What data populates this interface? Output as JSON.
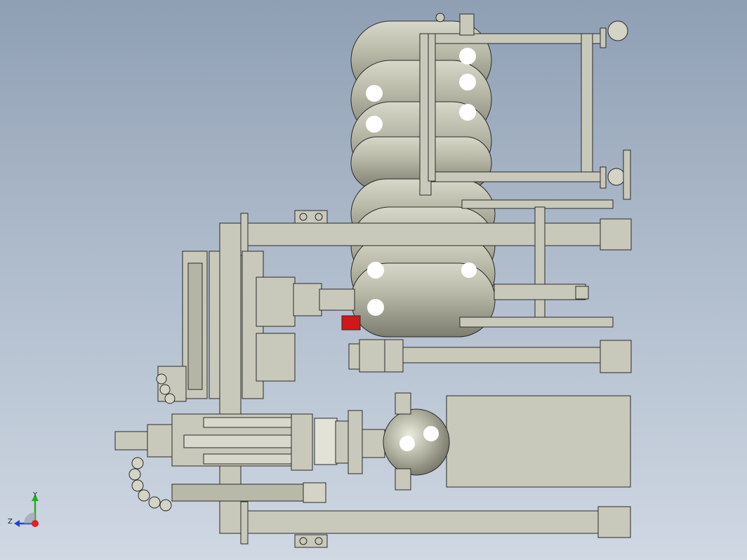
{
  "viewport": {
    "background_top": "#8f9fb4",
    "background_bottom": "#cfd8e3"
  },
  "colors": {
    "part_fill": "#c9c9bb",
    "part_fill_dark": "#a9a99a",
    "outline": "#2a2a2a",
    "tank_fill": "#b8b8a6",
    "highlight": "#ffffff",
    "accent_red": "#d01818"
  },
  "triad": {
    "x_label": "",
    "y_label": "Y",
    "z_label": "Z",
    "x_color": "#e02020",
    "y_color": "#20b020",
    "z_color": "#2040e0"
  }
}
